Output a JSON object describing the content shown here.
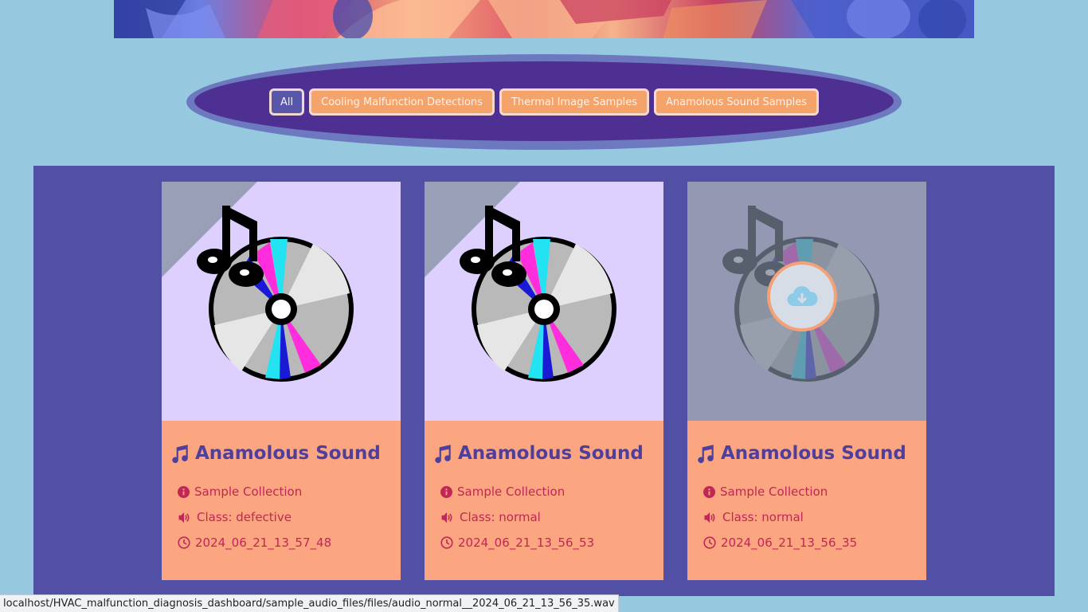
{
  "filters": {
    "all": "All",
    "cooling": "Cooling Malfunction Detections",
    "thermal": "Thermal Image Samples",
    "sound": "Anamolous Sound Samples"
  },
  "cards": [
    {
      "title": "Anamolous Sound",
      "collection": "Sample Collection",
      "class": "Class: defective",
      "timestamp": "2024_06_21_13_57_48"
    },
    {
      "title": "Anamolous Sound",
      "collection": "Sample Collection",
      "class": "Class: normal",
      "timestamp": "2024_06_21_13_56_53"
    },
    {
      "title": "Anamolous Sound",
      "collection": "Sample Collection",
      "class": "Class: normal",
      "timestamp": "2024_06_21_13_56_35"
    }
  ],
  "status_bar": {
    "url": "localhost/HVAC_malfunction_diagnosis_dashboard/sample_audio_files/files/audio_normal__2024_06_21_13_56_35.wav"
  },
  "colors": {
    "background": "#96c8df",
    "gallery": "#5250a4",
    "filter_bar": "#4e2f92",
    "filter_button": "#f4a46b",
    "card_info": "#fca581",
    "title_text": "#4f3f9c",
    "meta_text": "#c02656"
  },
  "icons": [
    "music-note-icon",
    "info-circle-icon",
    "speaker-icon",
    "clock-icon",
    "cloud-download-icon",
    "cd-disc-icon"
  ]
}
